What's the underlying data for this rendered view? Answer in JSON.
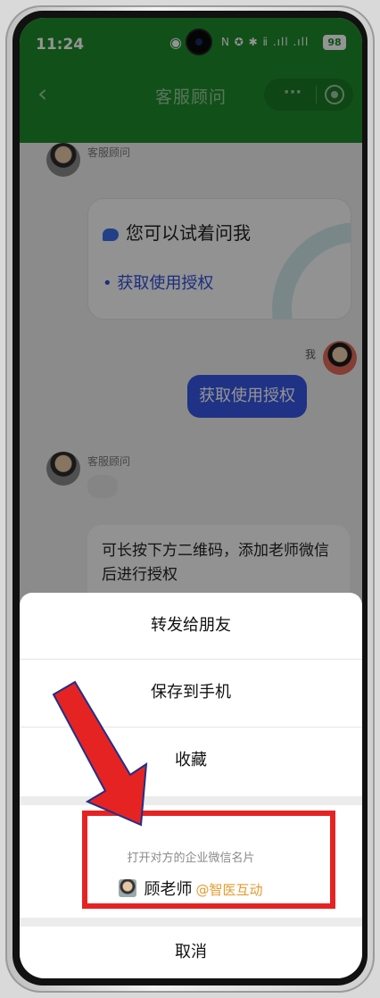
{
  "status_bar": {
    "time": "11:24",
    "icons": "N ✪ ✱ ⅱ .ıll .ıll",
    "battery": "98"
  },
  "nav": {
    "back_icon": "‹",
    "title": "客服顾问",
    "more_icon": "···"
  },
  "chat": {
    "advisor_name": "客服顾问",
    "card_question": "您可以试着问我",
    "card_link": "获取使用授权",
    "me_label": "我",
    "me_message": "获取使用授权",
    "advisor_name_2": "客服顾问",
    "reply_text": "可长按下方二维码，添加老师微信后进行授权"
  },
  "sheet": {
    "forward": "转发给朋友",
    "save": "保存到手机",
    "favorite": "收藏",
    "contact_hint": "打开对方的企业微信名片",
    "contact_name": "顾老师",
    "contact_org": "@智医互动",
    "cancel": "取消"
  },
  "colors": {
    "header_green": "#1e8a2b",
    "bubble_blue": "#3656e6",
    "highlight_red": "#e62323",
    "org_orange": "#e69a2e"
  }
}
